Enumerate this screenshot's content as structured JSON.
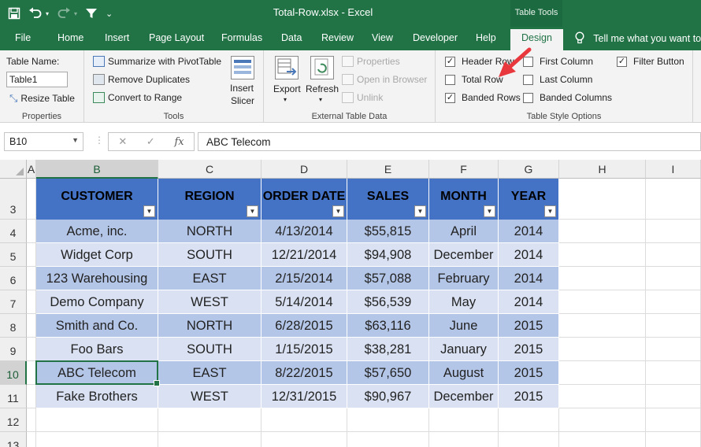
{
  "titlebar": {
    "title": "Total-Row.xlsx  -  Excel",
    "contextual_tab_group": "Table Tools"
  },
  "tabs": {
    "file": "File",
    "home": "Home",
    "insert": "Insert",
    "page_layout": "Page Layout",
    "formulas": "Formulas",
    "data": "Data",
    "review": "Review",
    "view": "View",
    "developer": "Developer",
    "help": "Help",
    "design": "Design",
    "tell_me": "Tell me what you want to"
  },
  "ribbon": {
    "properties": {
      "table_name_label": "Table Name:",
      "table_name_value": "Table1",
      "resize_table": "Resize Table",
      "group_label": "Properties"
    },
    "tools": {
      "summarize": "Summarize with PivotTable",
      "remove_duplicates": "Remove Duplicates",
      "convert_to_range": "Convert to Range",
      "insert_slicer_line1": "Insert",
      "insert_slicer_line2": "Slicer",
      "group_label": "Tools"
    },
    "external": {
      "export": "Export",
      "refresh": "Refresh",
      "properties": "Properties",
      "open_in_browser": "Open in Browser",
      "unlink": "Unlink",
      "group_label": "External Table Data"
    },
    "style_options": {
      "header_row": "Header Row",
      "total_row": "Total Row",
      "banded_rows": "Banded Rows",
      "first_column": "First Column",
      "last_column": "Last Column",
      "banded_columns": "Banded Columns",
      "filter_button": "Filter Button",
      "header_row_checked": true,
      "total_row_checked": false,
      "banded_rows_checked": true,
      "first_column_checked": false,
      "last_column_checked": false,
      "banded_columns_checked": false,
      "filter_button_checked": true,
      "group_label": "Table Style Options"
    }
  },
  "formula_bar": {
    "name_box": "B10",
    "cancel_symbol": "✕",
    "enter_symbol": "✓",
    "fx_symbol": "fx",
    "content": "ABC Telecom"
  },
  "grid": {
    "columns": [
      "A",
      "B",
      "C",
      "D",
      "E",
      "F",
      "G",
      "H",
      "I"
    ],
    "rows": [
      "3",
      "4",
      "5",
      "6",
      "7",
      "8",
      "9",
      "10",
      "11",
      "12",
      "13"
    ],
    "active_cell": "B10",
    "table_headers": [
      "CUSTOMER",
      "REGION",
      "ORDER DATE",
      "SALES",
      "MONTH",
      "YEAR"
    ],
    "table_rows": [
      [
        "Acme, inc.",
        "NORTH",
        "4/13/2014",
        "$55,815",
        "April",
        "2014"
      ],
      [
        "Widget Corp",
        "SOUTH",
        "12/21/2014",
        "$94,908",
        "December",
        "2014"
      ],
      [
        "123 Warehousing",
        "EAST",
        "2/15/2014",
        "$57,088",
        "February",
        "2014"
      ],
      [
        "Demo Company",
        "WEST",
        "5/14/2014",
        "$56,539",
        "May",
        "2014"
      ],
      [
        "Smith and Co.",
        "NORTH",
        "6/28/2015",
        "$63,116",
        "June",
        "2015"
      ],
      [
        "Foo Bars",
        "SOUTH",
        "1/15/2015",
        "$38,281",
        "January",
        "2015"
      ],
      [
        "ABC Telecom",
        "EAST",
        "8/22/2015",
        "$57,650",
        "August",
        "2015"
      ],
      [
        "Fake Brothers",
        "WEST",
        "12/31/2015",
        "$90,967",
        "December",
        "2015"
      ]
    ]
  },
  "colors": {
    "excel_green": "#217346",
    "table_header_blue": "#4472c4",
    "band_dark": "#b4c6e7",
    "band_light": "#d9e1f2",
    "annotation_arrow": "#e8383d"
  }
}
